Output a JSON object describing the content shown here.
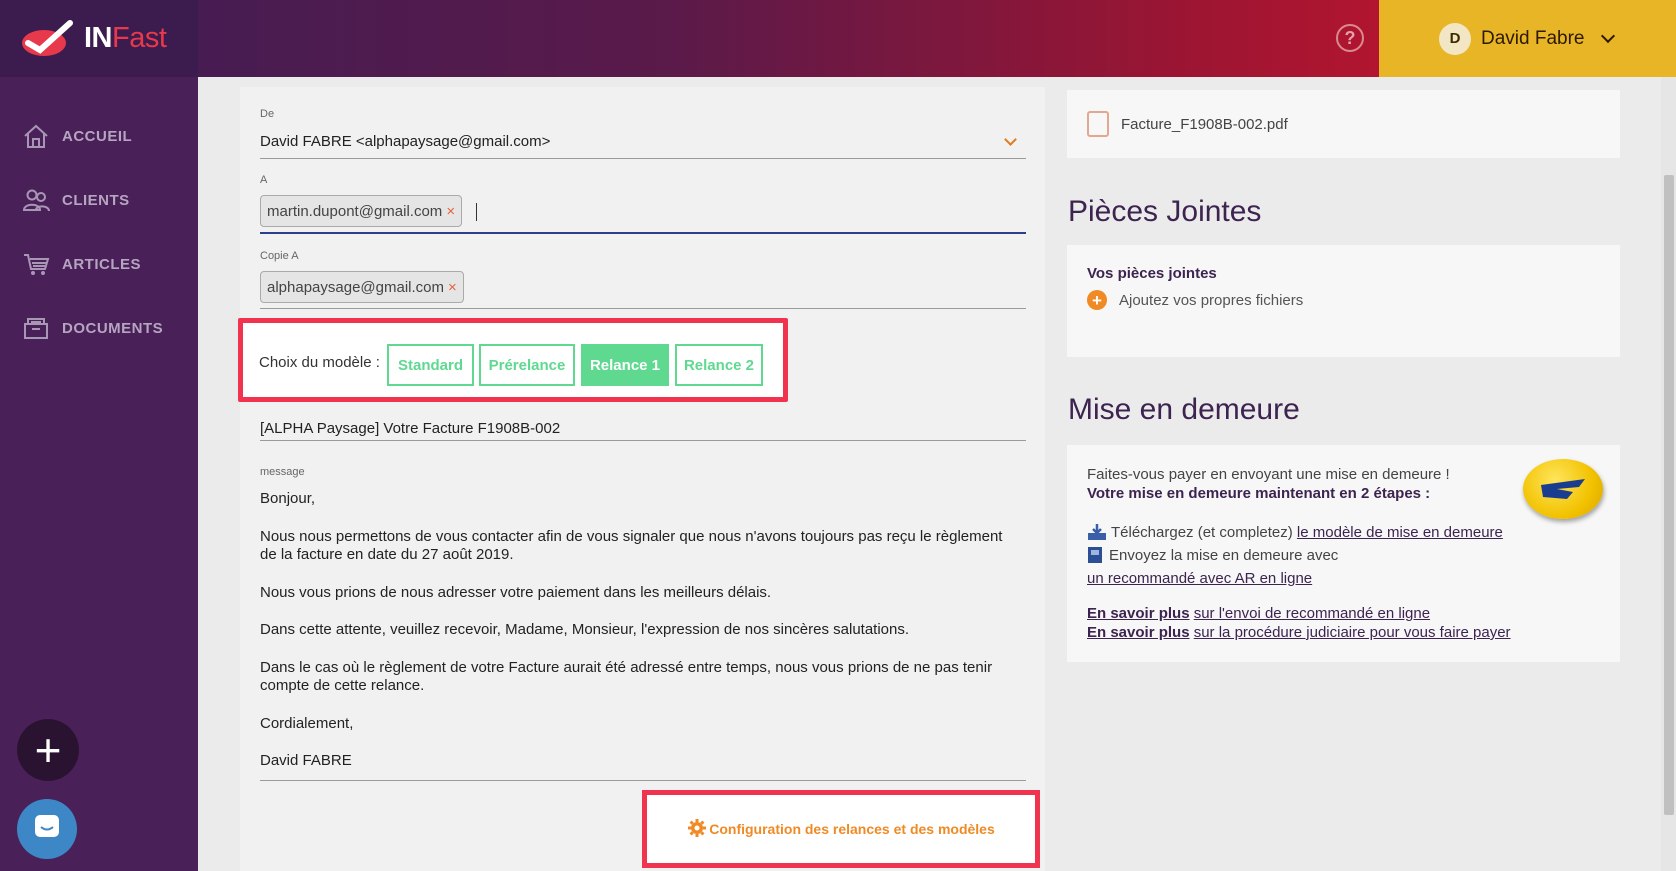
{
  "header": {
    "logo_in": "IN",
    "logo_fast": "Fast",
    "help_symbol": "?",
    "user_initial": "D",
    "user_name": "David Fabre"
  },
  "sidebar": {
    "items": [
      {
        "label": "ACCUEIL",
        "icon": "home-icon"
      },
      {
        "label": "CLIENTS",
        "icon": "users-icon"
      },
      {
        "label": "ARTICLES",
        "icon": "cart-icon"
      },
      {
        "label": "DOCUMENTS",
        "icon": "documents-icon"
      }
    ],
    "fab_plus": "+"
  },
  "email": {
    "from_label": "De",
    "from_value": "David FABRE <alphapaysage@gmail.com>",
    "to_label": "A",
    "to_chip": "martin.dupont@gmail.com",
    "cc_label": "Copie A",
    "cc_chip": "alphapaysage@gmail.com",
    "chip_remove": "×",
    "model_label": "Choix du modèle :",
    "models": [
      "Standard",
      "Prérelance",
      "Relance 1",
      "Relance 2"
    ],
    "active_model": "Relance 1",
    "subject_value": "[ALPHA Paysage] Votre Facture F1908B-002",
    "message_label": "message",
    "message_paragraphs": [
      "Bonjour,",
      "Nous nous permettons de vous contacter afin de vous signaler que nous n'avons toujours pas reçu le règlement de la facture en date du 27 août 2019.",
      "Nous vous prions de nous adresser votre paiement dans les meilleurs délais.",
      "Dans cette attente, veuillez recevoir, Madame, Monsieur, l'expression de nos sincères salutations.",
      "Dans le cas où le règlement de votre Facture aurait été adressé entre temps, nous vous prions de ne pas tenir compte de cette relance.",
      "Cordialement,",
      "David FABRE"
    ],
    "config_link": "Configuration des relances et des modèles"
  },
  "right": {
    "file_name": "Facture_F1908B-002.pdf",
    "attachments_title": "Pièces Jointes",
    "attachments_subtitle": "Vos pièces jointes",
    "attachments_add": "Ajoutez vos propres fichiers",
    "notice_title": "Mise en demeure",
    "notice_intro": "Faites-vous payer en envoyant une mise en demeure !",
    "notice_bold": "Votre mise en demeure maintenant en 2 étapes :",
    "step1_text": "Téléchargez (et completez)",
    "step1_link": "le modèle de mise en demeure",
    "step2_text": "Envoyez la mise en demeure avec",
    "step2_link": "un recommandé avec AR en ligne",
    "more1_bold": "En savoir plus",
    "more1_text": "sur l'envoi de recommandé en ligne",
    "more2_bold": "En savoir plus",
    "more2_text": "sur la procédure judiciaire pour vous faire payer"
  },
  "colors": {
    "accent_green": "#5ed98f",
    "highlight_red": "#f0334f",
    "orange": "#f08a24",
    "user_bar": "#e8b526"
  }
}
